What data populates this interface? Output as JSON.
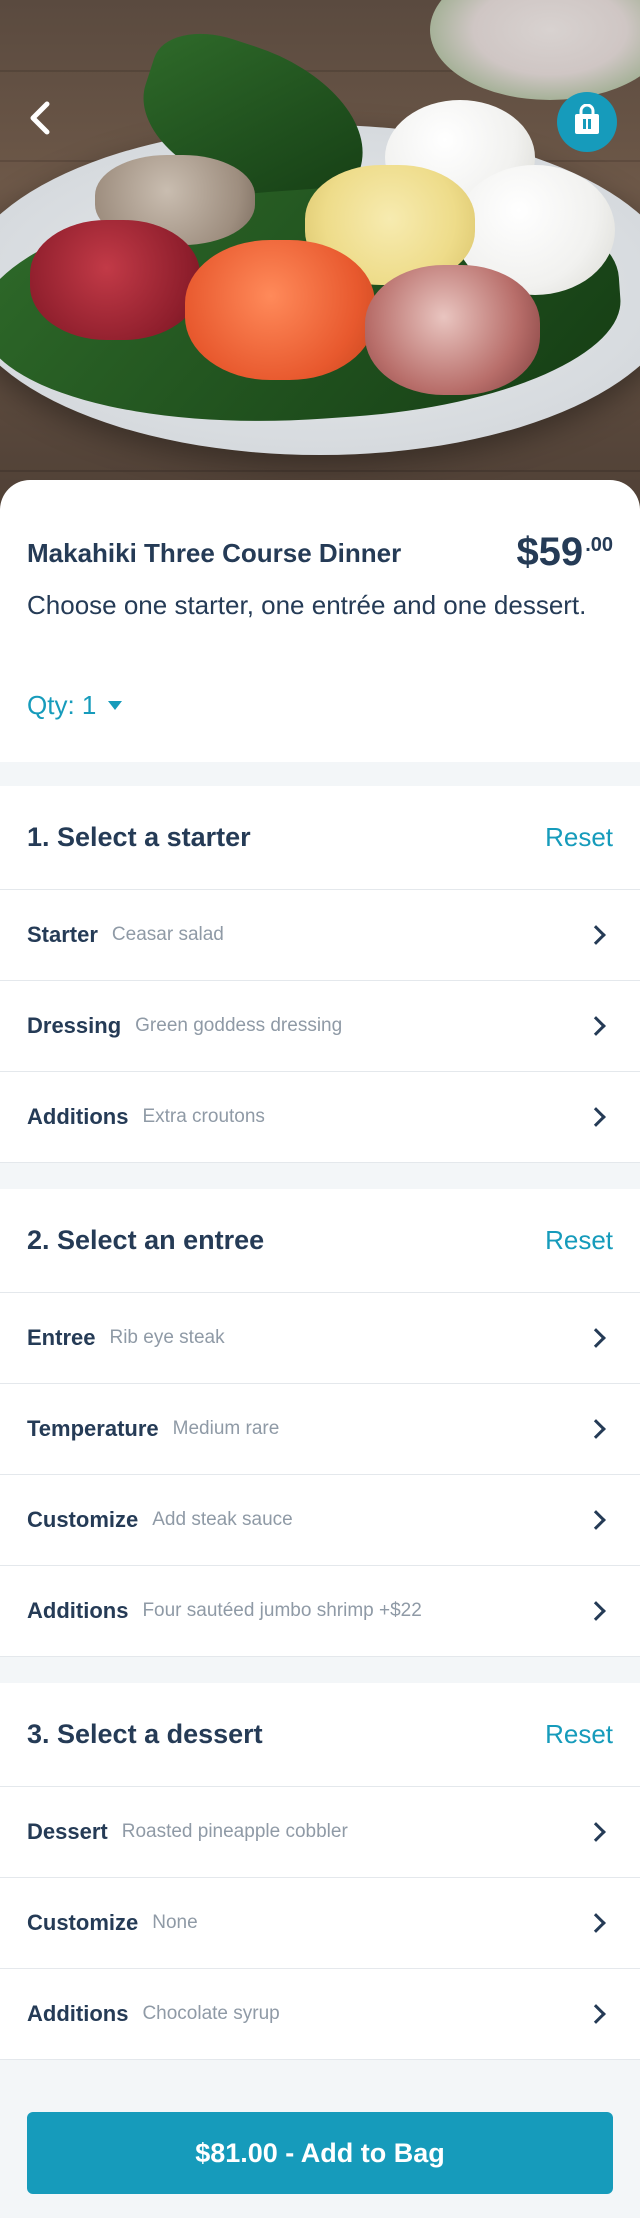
{
  "product": {
    "name": "Makahiki Three Course Dinner",
    "price_main": "$59",
    "price_cents": ".00",
    "description": "Choose one starter, one entrée and one dessert.",
    "qty_label": "Qty: 1"
  },
  "icons": {
    "back": "chevron-left-icon",
    "bag": "shopping-bag-icon",
    "row_chevron": "chevron-right-icon"
  },
  "sections": [
    {
      "title": "1. Select a starter",
      "reset": "Reset",
      "rows": [
        {
          "label": "Starter",
          "value": "Ceasar salad"
        },
        {
          "label": "Dressing",
          "value": "Green goddess dressing"
        },
        {
          "label": "Additions",
          "value": "Extra croutons"
        }
      ]
    },
    {
      "title": "2. Select an entree",
      "reset": "Reset",
      "rows": [
        {
          "label": "Entree",
          "value": "Rib eye steak"
        },
        {
          "label": "Temperature",
          "value": "Medium rare"
        },
        {
          "label": "Customize",
          "value": "Add steak sauce"
        },
        {
          "label": "Additions",
          "value": "Four sautéed jumbo shrimp  +$22"
        }
      ]
    },
    {
      "title": "3. Select a dessert",
      "reset": "Reset",
      "rows": [
        {
          "label": "Dessert",
          "value": "Roasted pineapple cobbler"
        },
        {
          "label": "Customize",
          "value": "None"
        },
        {
          "label": "Additions",
          "value": "Chocolate syrup"
        }
      ]
    }
  ],
  "footer": {
    "add_button": "$81.00 - Add to Bag"
  },
  "colors": {
    "accent": "#169bbb",
    "text": "#253b56",
    "muted": "#8f9aa6",
    "background": "#f3f6f8"
  }
}
